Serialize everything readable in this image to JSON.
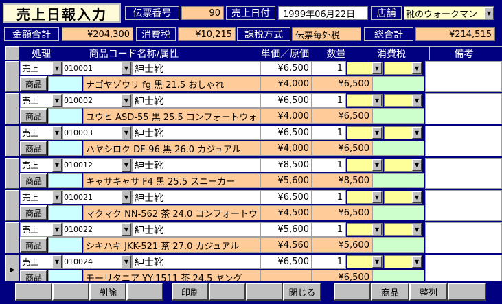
{
  "header": {
    "title": "売上日報入力",
    "slip_no_label": "伝票番号",
    "slip_no": "90",
    "sales_date_label": "売上日付",
    "sales_date": "1999年06月22日",
    "store_label": "店舗",
    "store": "靴のウォークマン"
  },
  "summary": {
    "amount_total_label": "金額合計",
    "amount_total": "¥204,300",
    "tax_label": "消費税",
    "tax": "¥10,215",
    "tax_method_label": "課税方式",
    "tax_method": "伝票毎外税",
    "grand_total_label": "総合計",
    "grand_total": "¥214,515"
  },
  "columns": {
    "process": "処理",
    "product": "商品コード名称/属性",
    "unit_price": "単価／原価",
    "quantity": "数量",
    "tax": "消費税",
    "remarks": "備考"
  },
  "rows": [
    {
      "process": "売上",
      "code": "010001",
      "category": "紳士靴",
      "price": "¥6,500",
      "qty": "1",
      "item_btn": "商品",
      "name": "ナゴヤゾウリ fg 黒 21.5 おしゃれ",
      "cost": "¥4,000",
      "amount": "¥6,500"
    },
    {
      "process": "売上",
      "code": "010002",
      "category": "紳士靴",
      "price": "¥6,500",
      "qty": "1",
      "item_btn": "商品",
      "name": "ユウヒ ASD-55 黒 25.5 コンフォートウォ",
      "cost": "¥4,000",
      "amount": "¥6,500"
    },
    {
      "process": "売上",
      "code": "010003",
      "category": "紳士靴",
      "price": "¥6,500",
      "qty": "1",
      "item_btn": "商品",
      "name": "ハヤシロク DF-96 黒 26.0 カジュアル",
      "cost": "¥4,000",
      "amount": "¥6,500"
    },
    {
      "process": "売上",
      "code": "010012",
      "category": "紳士靴",
      "price": "¥8,500",
      "qty": "1",
      "item_btn": "商品",
      "name": "キャサキャサ F4 黒 25.5 スニーカー",
      "cost": "¥5,600",
      "amount": "¥8,500"
    },
    {
      "process": "売上",
      "code": "010021",
      "category": "紳士靴",
      "price": "¥6,500",
      "qty": "1",
      "item_btn": "商品",
      "name": "マクマク NN-562 茶 24.0 コンフォートウ",
      "cost": "¥4,500",
      "amount": "¥6,500"
    },
    {
      "process": "売上",
      "code": "010022",
      "category": "紳士靴",
      "price": "¥5,600",
      "qty": "1",
      "item_btn": "商品",
      "name": "シキハキ JKK-521 茶 27.0 カジュアル",
      "cost": "¥4,560",
      "amount": "¥5,600"
    },
    {
      "process": "売上",
      "code": "010024",
      "category": "紳士靴",
      "price": "¥6,500",
      "qty": "1",
      "item_btn": "商品",
      "name": "モーリタニア YY-1511 茶 24.5 ヤング",
      "cost": "",
      "amount": "¥6,500"
    }
  ],
  "toolbar": {
    "delete": "削除",
    "print": "印刷",
    "close": "閉じる",
    "product": "商品",
    "sort": "整列"
  },
  "icons": {
    "dropdown": "chevron-down-icon",
    "current_record": "record-pointer-icon"
  },
  "colors": {
    "navy": "#000080",
    "peach": "#ffcc99",
    "cream": "#fffad8",
    "yellow": "#ffff99",
    "mint": "#ccffcc"
  }
}
